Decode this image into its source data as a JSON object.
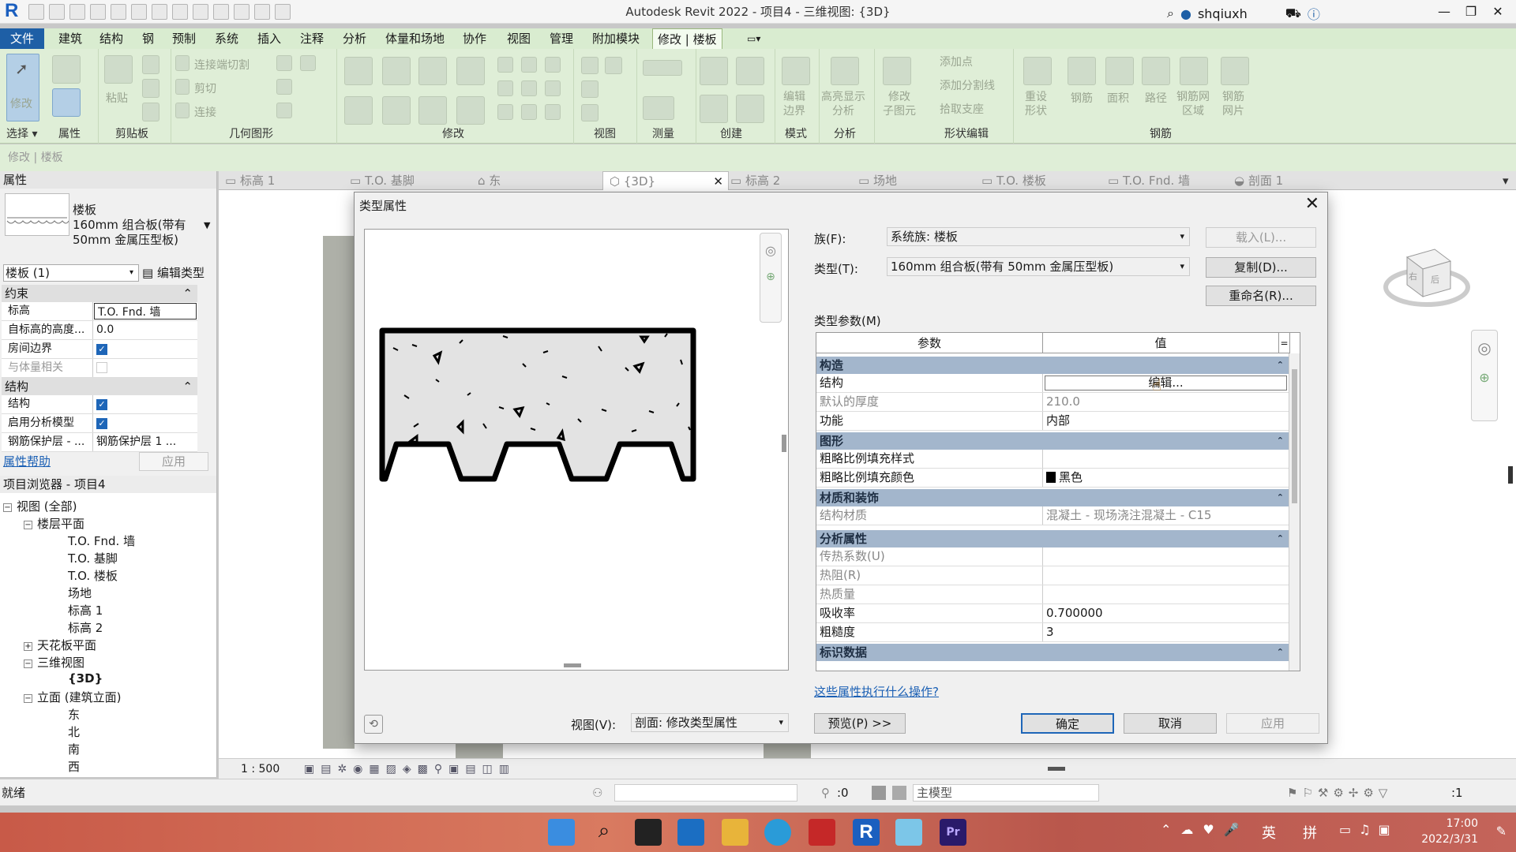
{
  "titlebar": {
    "title": "Autodesk Revit 2022 - 项目4 - 三维视图: {3D}",
    "username": "shqiuxh"
  },
  "menu": {
    "file": "文件",
    "tabs": [
      "建筑",
      "结构",
      "钢",
      "预制",
      "系统",
      "插入",
      "注释",
      "分析",
      "体量和场地",
      "协作",
      "视图",
      "管理",
      "附加模块",
      "修改 | 楼板"
    ]
  },
  "ribbon": {
    "select_label": "选择",
    "properties_label": "属性",
    "modify_label": "修改",
    "clipboard_label": "剪贴板",
    "paste_label": "粘贴",
    "geometry_label": "几何图形",
    "cut_join_label": "连接端切割",
    "cut_label": "剪切",
    "join_label": "连接",
    "modify_group_label": "修改",
    "view_group_label": "视图",
    "measure_group_label": "测量",
    "create_group_label": "创建",
    "mode_group_label": "模式",
    "analyze_group_label": "分析",
    "shape_group_label": "形状编辑",
    "rebar_group_label": "钢筋",
    "edit_boundary": "编辑\n边界",
    "highlight_analyze": "高亮显示\n分析",
    "modify_sub": "修改\n子图元",
    "add_point": "添加点",
    "add_split": "添加分割线",
    "pick_support": "拾取支座",
    "reset_shape": "重设\n形状",
    "rebar": "钢筋",
    "area": "面积",
    "path": "路径",
    "rebar_area": "钢筋网\n区域",
    "rebar_mesh": "钢筋\n网片"
  },
  "subbar": {
    "context": "修改 | 楼板"
  },
  "properties": {
    "header": "属性",
    "type_family": "楼板",
    "type_name_line1": "160mm 组合板(带有",
    "type_name_line2": "50mm 金属压型板)",
    "instance_selector": "楼板 (1)",
    "edit_type": "编辑类型",
    "sections": {
      "constraints": "约束",
      "structure": "结构"
    },
    "rows": [
      {
        "key": "标高",
        "value": "T.O. Fnd. 墙"
      },
      {
        "key": "自标高的高度...",
        "value": "0.0"
      },
      {
        "key": "房间边界",
        "value": ""
      },
      {
        "key": "与体量相关",
        "value": ""
      },
      {
        "key": "结构",
        "value": ""
      },
      {
        "key": "启用分析模型",
        "value": ""
      },
      {
        "key": "钢筋保护层 - ...",
        "value": "钢筋保护层 1 ..."
      }
    ],
    "help": "属性帮助",
    "apply": "应用"
  },
  "browser": {
    "header": "项目浏览器 - 项目4",
    "items": [
      {
        "label": "视图 (全部)"
      },
      {
        "label": "楼层平面"
      },
      {
        "label": "T.O. Fnd. 墙"
      },
      {
        "label": "T.O. 基脚"
      },
      {
        "label": "T.O. 楼板"
      },
      {
        "label": "场地"
      },
      {
        "label": "标高 1"
      },
      {
        "label": "标高 2"
      },
      {
        "label": "天花板平面"
      },
      {
        "label": "三维视图"
      },
      {
        "label": "{3D}"
      },
      {
        "label": "立面 (建筑立面)"
      },
      {
        "label": "东"
      },
      {
        "label": "北"
      },
      {
        "label": "南"
      },
      {
        "label": "西"
      }
    ]
  },
  "viewtabs": [
    "标高 1",
    "T.O. 基脚",
    "东",
    "{3D}",
    "标高 2",
    "场地",
    "T.O. 楼板",
    "T.O. Fnd. 墙",
    "剖面 1"
  ],
  "viewcontrol": {
    "scale": "1 : 500"
  },
  "statusbar": {
    "ready": "就绪",
    "zero": ":0",
    "model": "主模型",
    "filter": ":1"
  },
  "taskbar": {
    "lang": "英",
    "ime": "拼",
    "time": "17:00",
    "date": "2022/3/31"
  },
  "dialog": {
    "title": "类型属性",
    "family_label": "族(F):",
    "family_value": "系统族: 楼板",
    "type_label": "类型(T):",
    "type_value": "160mm 组合板(带有 50mm 金属压型板)",
    "load_btn": "载入(L)...",
    "duplicate_btn": "复制(D)...",
    "rename_btn": "重命名(R)...",
    "type_params_label": "类型参数(M)",
    "col_param": "参数",
    "col_value": "值",
    "sections": {
      "construction": "构造",
      "graphics": "图形",
      "materials": "材质和装饰",
      "analytical": "分析属性",
      "identity": "标识数据"
    },
    "rows": {
      "structure": {
        "k": "结构",
        "v": "编辑..."
      },
      "default_thickness": {
        "k": "默认的厚度",
        "v": "210.0"
      },
      "function": {
        "k": "功能",
        "v": "内部"
      },
      "coarse_pattern": {
        "k": "粗略比例填充样式",
        "v": ""
      },
      "coarse_color": {
        "k": "粗略比例填充颜色",
        "v": "黑色"
      },
      "struct_material": {
        "k": "结构材质",
        "v": "混凝土 - 现场浇注混凝土 - C15"
      },
      "heat_transfer": {
        "k": "传热系数(U)",
        "v": ""
      },
      "thermal_resistance": {
        "k": "热阻(R)",
        "v": ""
      },
      "thermal_mass": {
        "k": "热质量",
        "v": ""
      },
      "absorptance": {
        "k": "吸收率",
        "v": "0.700000"
      },
      "roughness": {
        "k": "粗糙度",
        "v": "3"
      }
    },
    "what_link": "这些属性执行什么操作?",
    "view_label": "视图(V):",
    "view_value": "剖面: 修改类型属性",
    "preview_btn": "预览(P) >>",
    "ok_btn": "确定",
    "cancel_btn": "取消",
    "apply_btn": "应用"
  },
  "colors": {
    "accent": "#1e5fa6",
    "ribbon_bg": "#dfeed7",
    "section_header": "#a3b6cc"
  }
}
